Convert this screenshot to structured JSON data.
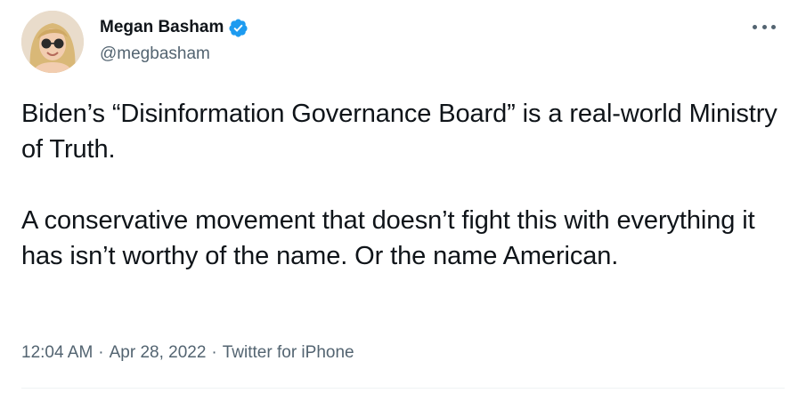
{
  "author": {
    "display_name": "Megan Basham",
    "handle": "@megbasham",
    "verified": true
  },
  "tweet": {
    "paragraphs": [
      "Biden’s “Disinformation Governance Board” is a real-world Ministry of Truth.",
      "A conservative movement that doesn’t fight this with everything it has isn’t worthy of the name. Or the name American."
    ],
    "time": "12:04 AM",
    "date": "Apr 28, 2022",
    "source": "Twitter for iPhone",
    "separator": "·"
  },
  "icons": {
    "verified": "verified-badge-icon",
    "more": "more-options-icon"
  },
  "colors": {
    "text": "#0f1419",
    "secondary": "#536471",
    "verified_blue": "#1d9bf0",
    "divider": "#eff3f4"
  }
}
